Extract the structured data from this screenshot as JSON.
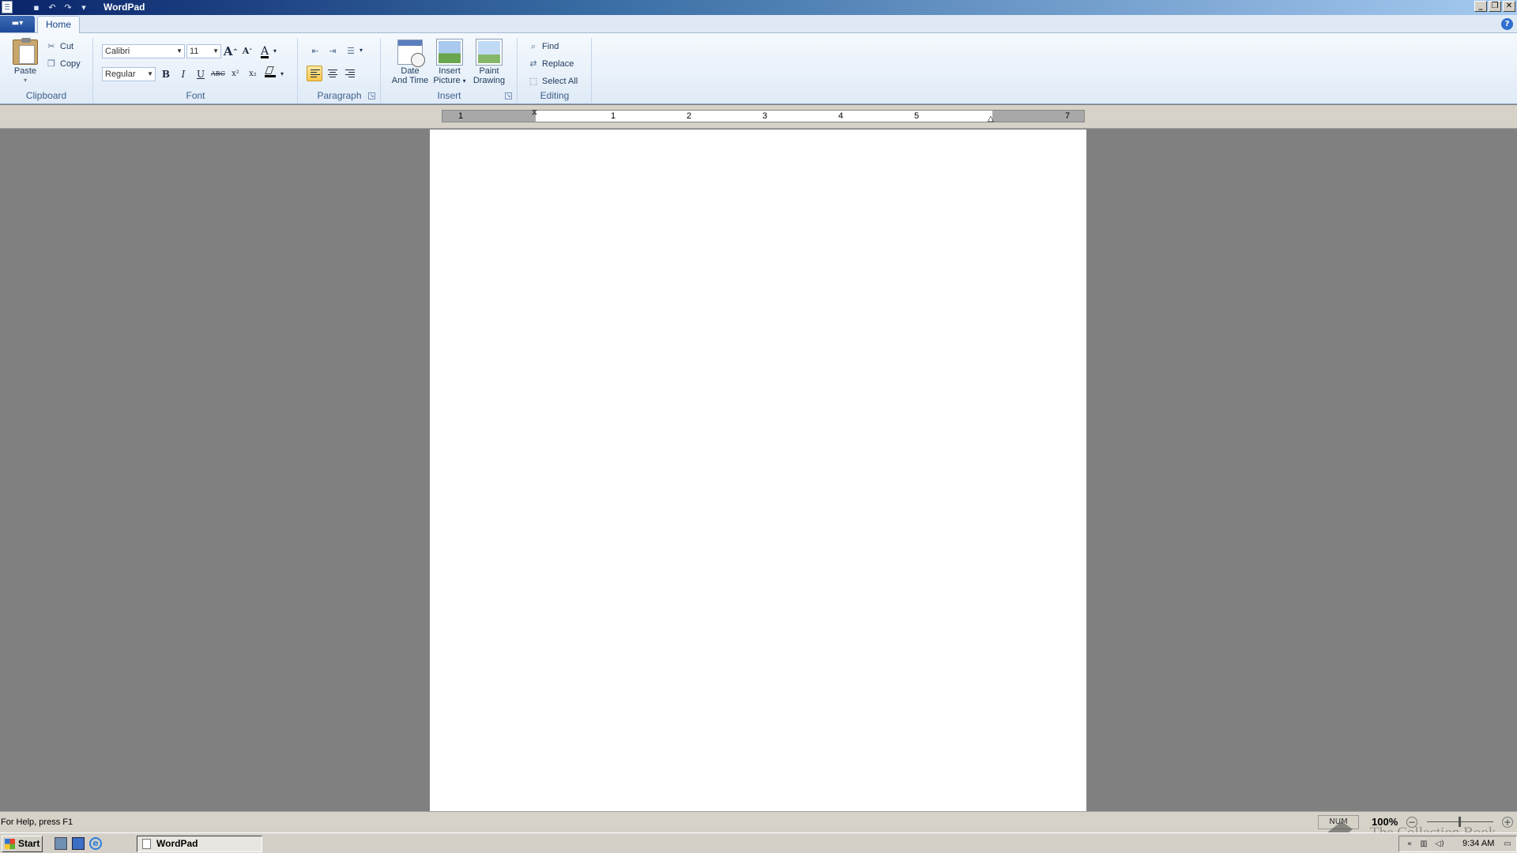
{
  "window": {
    "title": "WordPad"
  },
  "tabs": {
    "home": "Home"
  },
  "clipboard": {
    "group_label": "Clipboard",
    "paste": "Paste",
    "cut": "Cut",
    "copy": "Copy"
  },
  "font": {
    "group_label": "Font",
    "family": "Calibri",
    "size": "11",
    "style": "Regular",
    "bold": "B",
    "italic": "I",
    "underline": "U",
    "strikethrough": "ABC",
    "superscript": "x²",
    "subscript": "x₂",
    "color_letter": "A"
  },
  "paragraph": {
    "group_label": "Paragraph"
  },
  "insert": {
    "group_label": "Insert",
    "date_time_line1": "Date",
    "date_time_line2": "And Time",
    "picture_line1": "Insert",
    "picture_line2": "Picture",
    "paint_line1": "Paint",
    "paint_line2": "Drawing"
  },
  "editing": {
    "group_label": "Editing",
    "find": "Find",
    "replace": "Replace",
    "select_all": "Select All"
  },
  "ruler": {
    "numbers": [
      "1",
      "1",
      "2",
      "3",
      "4",
      "5",
      "7"
    ]
  },
  "status": {
    "help_text": "For Help, press F1",
    "num": "NUM",
    "zoom": "100%",
    "watermark": "The Collection Book"
  },
  "taskbar": {
    "start": "Start",
    "task": "WordPad",
    "clock": "9:34 AM"
  },
  "colors": {
    "accent": "#1e395b",
    "highlight": "#ffc84a",
    "page": "#ffffff",
    "workspace": "#808080"
  }
}
